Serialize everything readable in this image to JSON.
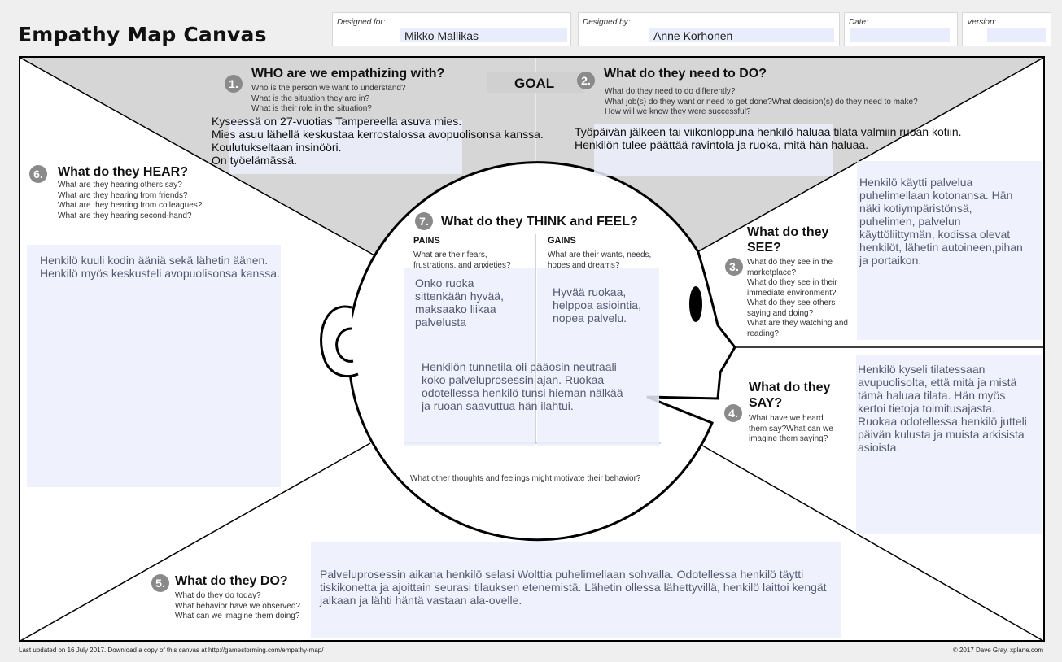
{
  "title": "Empathy Map Canvas",
  "header": {
    "designed_for_label": "Designed for:",
    "designed_for_value": "Mikko Mallikas",
    "designed_by_label": "Designed by:",
    "designed_by_value": "Anne Korhonen",
    "date_label": "Date:",
    "version_label": "Version:"
  },
  "goal": "GOAL",
  "who": {
    "num": "1.",
    "title": "WHO are we empathizing with?",
    "questions": [
      "Who is the person we want to understand?",
      "What is the situation they are in?",
      "What is their role in the situation?"
    ],
    "answer": [
      "Kyseessä on 27-vuotias Tampereella asuva mies.",
      "Mies asuu lähellä keskustaa kerrostalossa avopuolisonsa kanssa.",
      "Koulutukseltaan insinööri.",
      "On työelämässä."
    ]
  },
  "do_need": {
    "num": "2.",
    "title": "What do they need to DO?",
    "questions": [
      "What do they need to do differently?",
      "What job(s) do they want or need to get done?What decision(s) do they need to make?",
      "How will we know they were successful?"
    ],
    "answer": [
      "Työpäivän jälkeen tai viikonloppuna henkilö haluaa tilata valmiin ruoan kotiin.",
      "Henkilön tulee päättää ravintola ja ruoka, mitä hän haluaa."
    ]
  },
  "see": {
    "num": "3.",
    "title": "What do they SEE?",
    "questions": [
      "What do they see in the marketplace?",
      "What do they see in their immediate environment?",
      "What do they see others saying and doing?",
      "What are they watching and reading?"
    ],
    "answer": "Henkilö käytti palvelua puhelimellaan kotonansa. Hän näki kotiympäristönsä, puhelimen, palvelun käyttöliittymän, kodissa olevat henkilöt, lähetin autoineen,pihan ja portaikon."
  },
  "say": {
    "num": "4.",
    "title": "What do they SAY?",
    "questions": [
      "What have we heard them say?What can we imagine them saying?"
    ],
    "answer": "Henkilö kyseli tilatessaan avupuolisolta, että mitä ja mistä tämä haluaa tilata. Hän myös kertoi tietoja toimitusajasta. Ruokaa odotellessa henkilö jutteli päivän kulusta ja muista arkisista asioista."
  },
  "do": {
    "num": "5.",
    "title": "What do they DO?",
    "questions": [
      "What do they do today?",
      "What behavior have we observed?",
      "What can we imagine them doing?"
    ],
    "answer": "Palveluprosessin aikana henkilö selasi Wolttia puhelimellaan sohvalla. Odotellessa henkilö täytti tiskikonetta ja ajoittain seurasi tilauksen etenemistä. Lähetin ollessa lähettyvillä, henkilö laittoi kengät jalkaan ja lähti häntä vastaan ala-ovelle."
  },
  "hear": {
    "num": "6.",
    "title": "What do they HEAR?",
    "questions": [
      "What are they hearing others say?",
      "What are they hearing from friends?",
      "What are they hearing from colleagues?What are they hearing second-hand?"
    ],
    "answer": "Henkilö kuuli kodin ääniä sekä lähetin äänen. Henkilö myös keskusteli avopuolisonsa kanssa."
  },
  "think": {
    "num": "7.",
    "title": "What do they THINK and FEEL?",
    "pains_label": "PAINS",
    "pains_q": "What are their fears, frustrations, and anxieties?",
    "pains_answer": "Onko ruoka sittenkään hyvää, maksaako liikaa palvelusta",
    "gains_label": "GAINS",
    "gains_q": "What are their wants, needs, hopes and dreams?",
    "gains_answer": "Hyvää ruokaa, helppoa asiointia, nopea palvelu.",
    "feeling_answer": "Henkilön tunnetila oli pääosin neutraali koko palveluprosessin ajan. Ruokaa odotellessa henkilö tunsi hieman nälkää ja ruoan saavuttua hän ilahtui.",
    "bottom_q": "What other thoughts and feelings might motivate their behavior?"
  },
  "footer": {
    "left": "Last updated on 16 July 2017. Download a copy of this canvas at http://gamestorming.com/empathy-map/",
    "right": "© 2017 Dave Gray, xplane.com"
  }
}
